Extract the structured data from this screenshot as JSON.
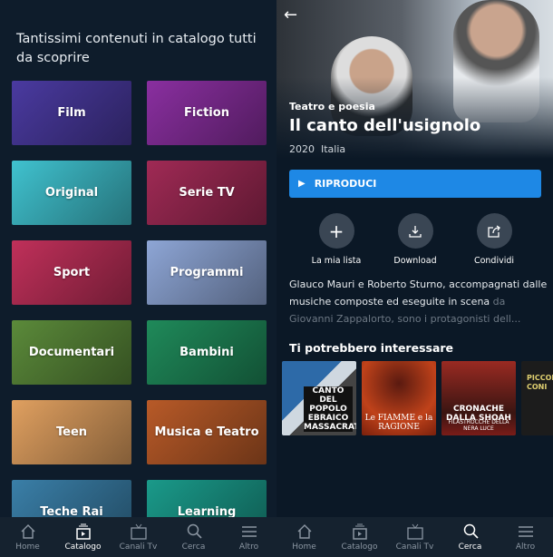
{
  "catalog": {
    "heading": "Tantissimi contenuti in catalogo tutti da scoprire",
    "tiles": [
      {
        "label": "Film",
        "color": "#4a3aa0"
      },
      {
        "label": "Fiction",
        "color": "#8a2fa0"
      },
      {
        "label": "Original",
        "color": "#40c2cf"
      },
      {
        "label": "Serie TV",
        "color": "#a02a55"
      },
      {
        "label": "Sport",
        "color": "#c0305a"
      },
      {
        "label": "Programmi",
        "color": "#8ea6d6"
      },
      {
        "label": "Documentari",
        "color": "#5b8a3a"
      },
      {
        "label": "Bambini",
        "color": "#1f8a5a"
      },
      {
        "label": "Teen",
        "color": "#e0a060"
      },
      {
        "label": "Musica e Teatro",
        "color": "#b85a28"
      },
      {
        "label": "Teche Rai",
        "color": "#3a7fa8"
      },
      {
        "label": "Learning",
        "color": "#1a9a8a"
      }
    ]
  },
  "nav_left": [
    {
      "label": "Home",
      "icon": "home-icon"
    },
    {
      "label": "Catalogo",
      "icon": "catalog-icon",
      "active": true
    },
    {
      "label": "Canali Tv",
      "icon": "tv-icon"
    },
    {
      "label": "Cerca",
      "icon": "search-icon"
    },
    {
      "label": "Altro",
      "icon": "menu-icon"
    }
  ],
  "nav_right": [
    {
      "label": "Home",
      "icon": "home-icon"
    },
    {
      "label": "Catalogo",
      "icon": "catalog-icon"
    },
    {
      "label": "Canali Tv",
      "icon": "tv-icon"
    },
    {
      "label": "Cerca",
      "icon": "search-icon",
      "active": true
    },
    {
      "label": "Altro",
      "icon": "menu-icon"
    }
  ],
  "detail": {
    "genre": "Teatro e poesia",
    "title": "Il canto dell'usignolo",
    "year": "2020",
    "country": "Italia",
    "play_label": "RIPRODUCI",
    "accent": "#1e88e5",
    "actions": [
      {
        "label": "La mia lista",
        "icon": "plus-icon"
      },
      {
        "label": "Download",
        "icon": "download-icon"
      },
      {
        "label": "Condividi",
        "icon": "share-icon"
      }
    ],
    "description_1": "Glauco Mauri e Roberto Sturno, accompagnati dalle musiche composte ed eseguite in scena",
    "description_2": "da Giovanni Zappalorto, sono i protagonisti dell...",
    "related_title": "Ti potrebbero interessare",
    "related": [
      {
        "title": "CANTO DEL POPOLO EBRAICO MASSACRATO"
      },
      {
        "title": "Le FIAMME e la RAGIONE"
      },
      {
        "title": "CRONACHE DALLA SHOAH",
        "subtitle": "FILASTROCCHE DELLA NERA LUCE"
      },
      {
        "title": "PICCOLI CONI"
      }
    ]
  }
}
